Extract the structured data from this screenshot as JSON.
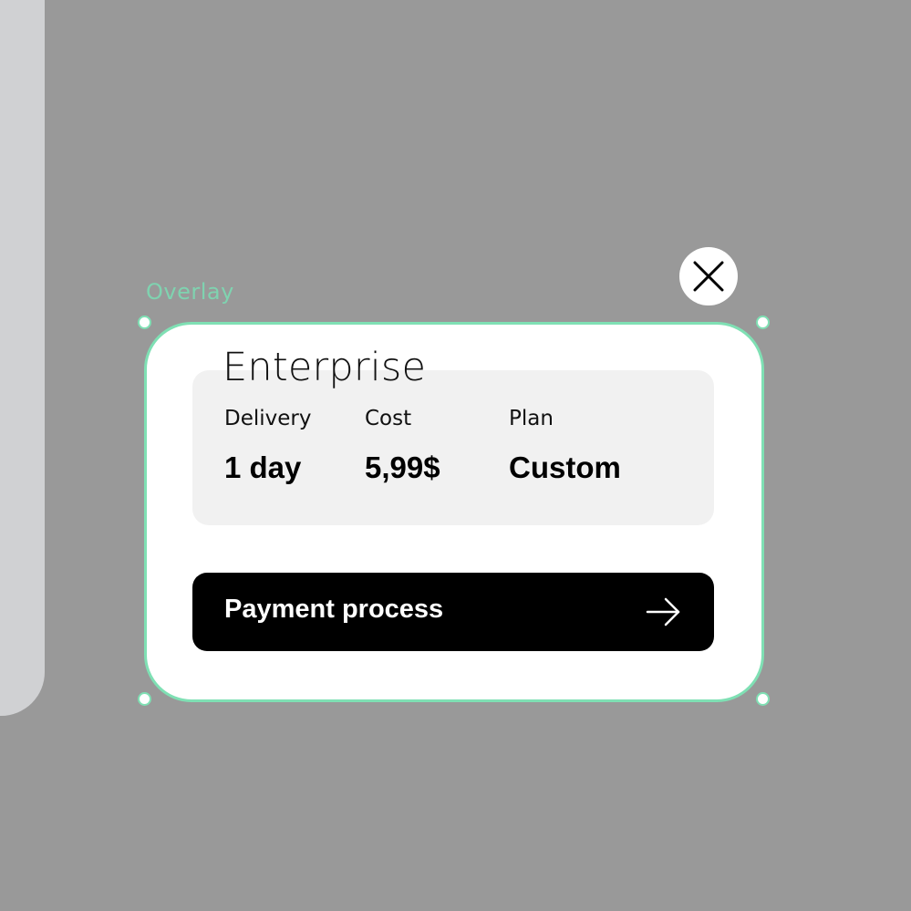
{
  "canvas": {
    "background": "#999999",
    "selection_color": "#7fe0b4"
  },
  "overlay": {
    "layer_label": "Overlay"
  },
  "close": {
    "icon": "close-icon"
  },
  "card": {
    "title": "Enterprise",
    "details": [
      {
        "label": "Delivery",
        "value": "1 day"
      },
      {
        "label": "Cost",
        "value": "5,99$"
      },
      {
        "label": "Plan",
        "value": "Custom"
      }
    ],
    "button_label": "Payment process",
    "button_icon": "arrow-right-icon"
  }
}
